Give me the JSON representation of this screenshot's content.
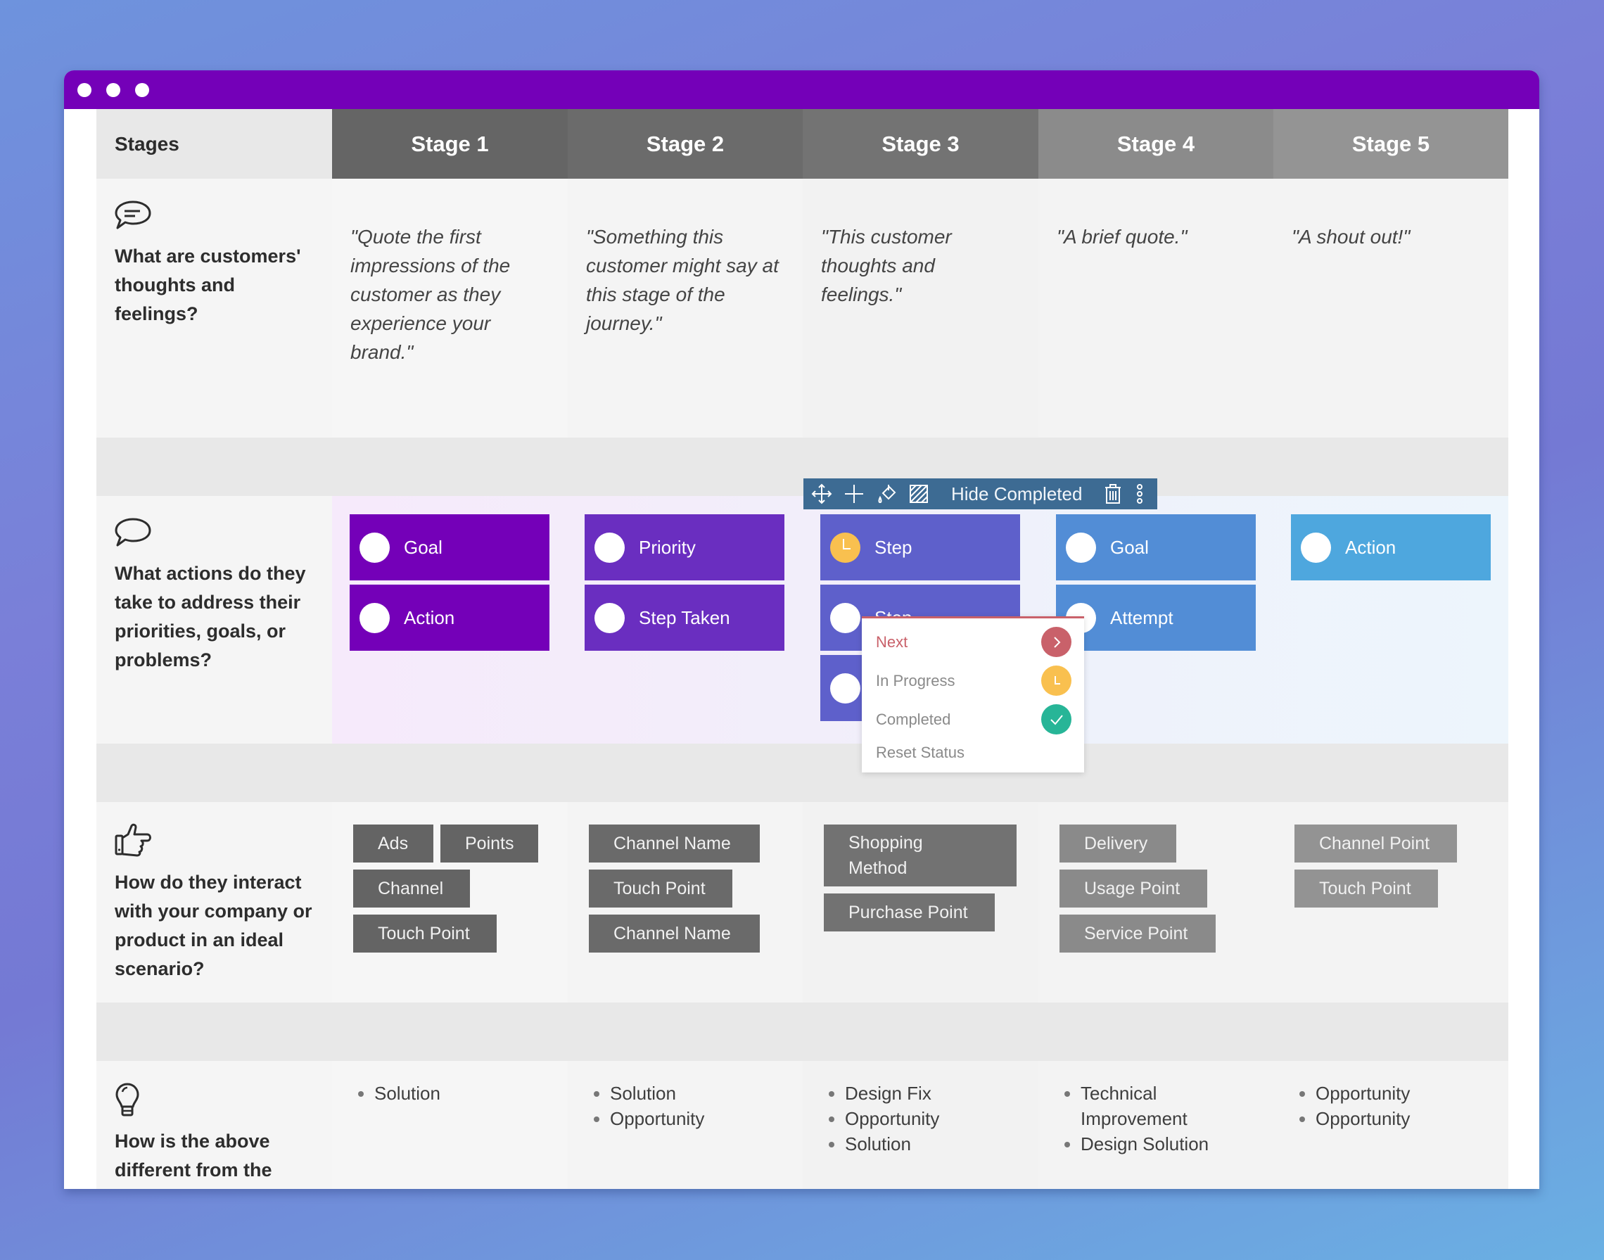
{
  "window": {
    "titlebar_color": "#7400B8",
    "controls": [
      "window-dot-1",
      "window-dot-2",
      "window-dot-3"
    ]
  },
  "header": {
    "label": "Stages",
    "stages": [
      {
        "label": "Stage 1",
        "color": "#656565"
      },
      {
        "label": "Stage 2",
        "color": "#6b6b6b"
      },
      {
        "label": "Stage 3",
        "color": "#737373"
      },
      {
        "label": "Stage 4",
        "color": "#8b8b8b"
      },
      {
        "label": "Stage 5",
        "color": "#949494"
      }
    ]
  },
  "rows": {
    "thoughts": {
      "icon": "speech-bubble-lines-icon",
      "question": "What are customers' thoughts and feelings?",
      "quotes": [
        "\"Quote the first impressions of the customer as they experience your brand.\"",
        "\"Something this customer might say at this stage of the journey.\"",
        "\"This customer thoughts and feelings.\"",
        "\"A brief quote.\"",
        "\"A shout out!\""
      ]
    },
    "actions": {
      "icon": "speech-bubble-icon",
      "question": "What actions do they take to address their priorities, goals, or problems?",
      "columns": [
        {
          "color": "#7400B8",
          "cards": [
            {
              "label": "Goal",
              "status": "none"
            },
            {
              "label": "Action",
              "status": "none"
            }
          ]
        },
        {
          "color": "#6A2EC0",
          "cards": [
            {
              "label": "Priority",
              "status": "none"
            },
            {
              "label": "Step Taken",
              "status": "none"
            }
          ]
        },
        {
          "color": "#5E60CB",
          "cards": [
            {
              "label": "Step",
              "status": "in-progress"
            },
            {
              "label": "Step",
              "status": "none"
            },
            {
              "label": "",
              "status": "none"
            }
          ]
        },
        {
          "color": "#528DD6",
          "cards": [
            {
              "label": "Goal",
              "status": "none"
            },
            {
              "label": "Attempt",
              "status": "none"
            }
          ]
        },
        {
          "color": "#4EA7DE",
          "cards": [
            {
              "label": "Action",
              "status": "none"
            }
          ]
        }
      ]
    },
    "interactions": {
      "icon": "hand-pointing-icon",
      "question": "How do they interact with your company or product in an ideal scenario?",
      "columns": [
        {
          "color": "#646464",
          "tags": [
            "Ads",
            "Points",
            "Channel",
            "Touch Point"
          ]
        },
        {
          "color": "#6a6a6a",
          "tags": [
            "Channel Name",
            "Touch Point",
            "Channel Name"
          ]
        },
        {
          "color": "#727272",
          "tags": [
            "Shopping Method",
            "Purchase Point"
          ]
        },
        {
          "color": "#8a8a8a",
          "tags": [
            "Delivery",
            "Usage Point",
            "Service Point"
          ]
        },
        {
          "color": "#939393",
          "tags": [
            "Channel Point",
            "Touch Point"
          ]
        }
      ]
    },
    "differences": {
      "icon": "lightbulb-icon",
      "question": "How is the above different from the",
      "columns": [
        [
          "Solution"
        ],
        [
          "Solution",
          "Opportunity"
        ],
        [
          "Design Fix",
          "Opportunity",
          "Solution"
        ],
        [
          "Technical Improvement",
          "Design Solution"
        ],
        [
          "Opportunity",
          "Opportunity"
        ]
      ]
    }
  },
  "toolbar": {
    "icons": [
      "move-icon",
      "add-icon",
      "paint-bucket-icon",
      "pattern-fill-icon"
    ],
    "hide_completed_label": "Hide Completed",
    "trailing_icons": [
      "trash-icon",
      "more-vertical-icon"
    ],
    "color": "#3D6B93"
  },
  "status_menu": {
    "items": [
      {
        "label": "Next",
        "icon": "chevron-right-icon",
        "color": "#C9616A"
      },
      {
        "label": "In Progress",
        "icon": "clock-icon",
        "color": "#F9C04F"
      },
      {
        "label": "Completed",
        "icon": "check-icon",
        "color": "#27B597"
      },
      {
        "label": "Reset Status",
        "icon": "",
        "color": ""
      }
    ]
  }
}
